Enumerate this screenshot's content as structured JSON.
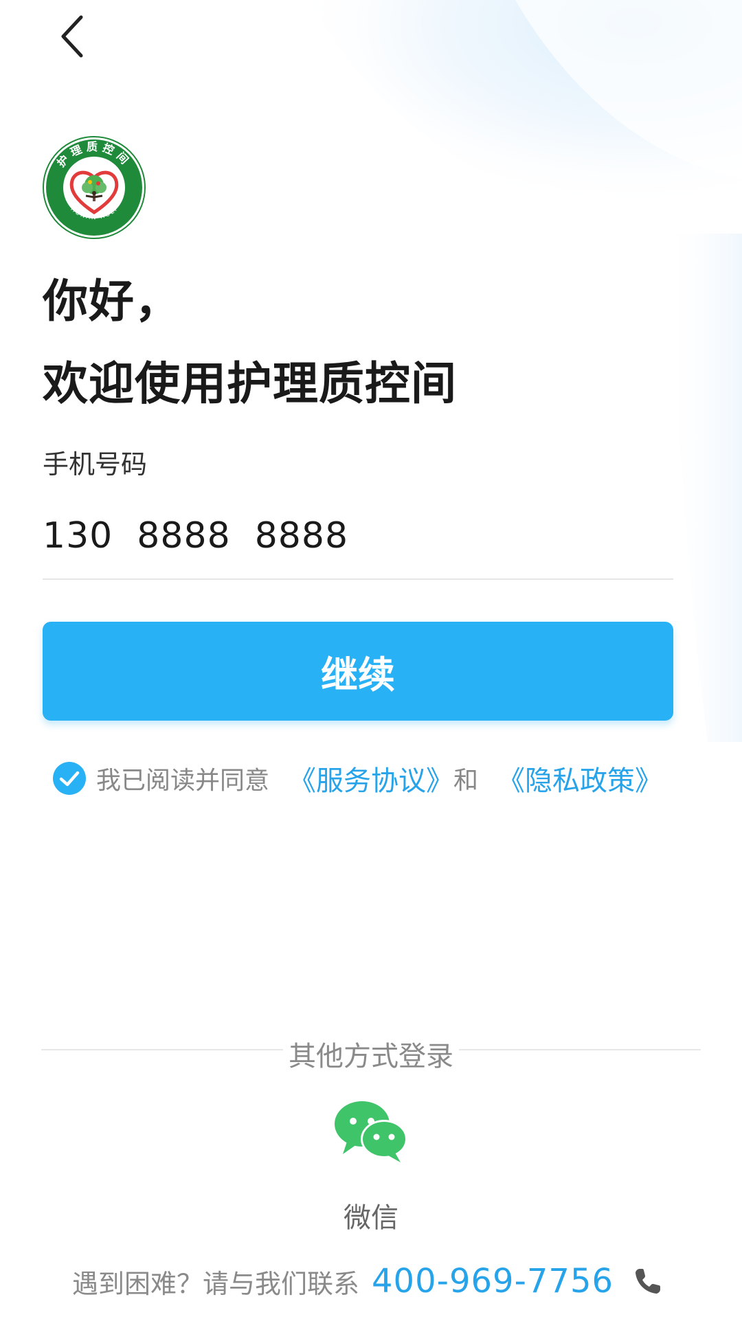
{
  "header": {
    "back_icon": "chevron-left-icon"
  },
  "logo": {
    "icon": "nursing-quality-logo",
    "ring_text": "护理质控间",
    "ring_text_bottom": "HUNAN HULI"
  },
  "greeting": {
    "line1": "你好，",
    "line2": "欢迎使用护理质控间"
  },
  "phone": {
    "label": "手机号码",
    "value": "130  8888  8888"
  },
  "continue_button": {
    "label": "继续",
    "color": "#28b1f5"
  },
  "agreement": {
    "checked": true,
    "prefix": "我已阅读并同意",
    "service_link": "《服务协议》",
    "and": "和",
    "privacy_link": "《隐私政策》",
    "link_color": "#27a3ea"
  },
  "other_login": {
    "label": "其他方式登录",
    "wechat_icon": "wechat-icon",
    "wechat_label": "微信",
    "wechat_color": "#3fc46a"
  },
  "contact": {
    "text": "遇到困难？请与我们联系",
    "phone": "400-969-7756",
    "icon": "phone-icon"
  }
}
